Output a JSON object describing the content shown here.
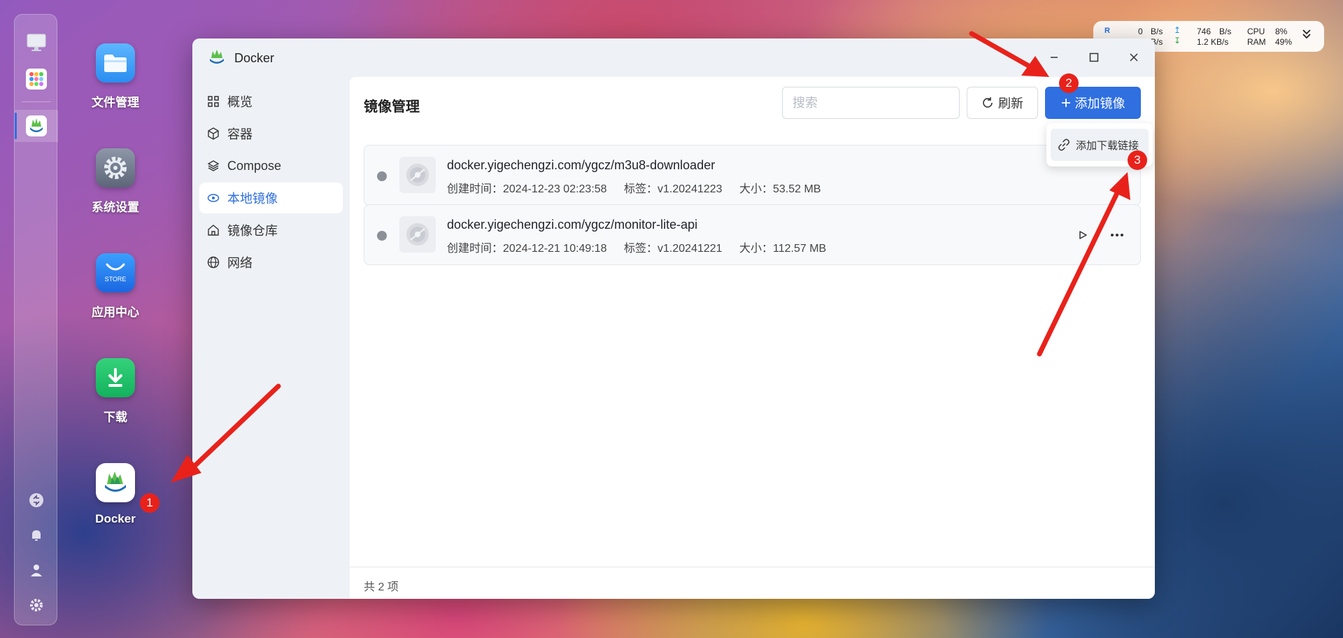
{
  "dock": {
    "icons": [
      "monitor-icon",
      "apps-grid-icon",
      "docker-icon",
      "sync-icon",
      "bell-icon",
      "user-icon",
      "gear-icon"
    ]
  },
  "desktop": {
    "apps": [
      {
        "label": "文件管理",
        "icon": "folder-icon"
      },
      {
        "label": "系统设置",
        "icon": "gear-icon"
      },
      {
        "label": "应用中心",
        "icon": "store-icon",
        "icon_text": "STORE"
      },
      {
        "label": "下载",
        "icon": "download-icon"
      },
      {
        "label": "Docker",
        "icon": "docker-icon"
      }
    ]
  },
  "sysmon": {
    "r_label": "R",
    "up_value": "0",
    "up_unit": "B/s",
    "up_total": "746",
    "up_total_unit": "B/s",
    "down_unit": "B/s",
    "down_total": "1.2 KB/s",
    "cpu_label": "CPU",
    "cpu_value": "8%",
    "ram_label": "RAM",
    "ram_value": "49%"
  },
  "window": {
    "title": "Docker",
    "sidebar": [
      {
        "label": "概览",
        "icon": "grid-icon"
      },
      {
        "label": "容器",
        "icon": "box-icon"
      },
      {
        "label": "Compose",
        "icon": "layers-icon"
      },
      {
        "label": "本地镜像",
        "icon": "disk-icon",
        "active": true
      },
      {
        "label": "镜像仓库",
        "icon": "home-icon"
      },
      {
        "label": "网络",
        "icon": "globe-icon"
      }
    ],
    "main": {
      "title": "镜像管理",
      "search_placeholder": "搜索",
      "refresh_label": "刷新",
      "add_label": "添加镜像",
      "images": [
        {
          "name": "docker.yigechengzi.com/ygcz/m3u8-downloader",
          "created": "创建时间：2024-12-23 02:23:58",
          "tag": "标签：v1.20241223",
          "size": "大小：53.52 MB"
        },
        {
          "name": "docker.yigechengzi.com/ygcz/monitor-lite-api",
          "created": "创建时间：2024-12-21 10:49:18",
          "tag": "标签：v1.20241221",
          "size": "大小：112.57 MB"
        }
      ],
      "footer": "共 2 项"
    },
    "dropdown": {
      "item_label": "添加下载链接"
    }
  },
  "annotations": {
    "markers": [
      "1",
      "2",
      "3"
    ],
    "color": "#e8221b"
  },
  "colors": {
    "accent": "#2f6fe0"
  }
}
